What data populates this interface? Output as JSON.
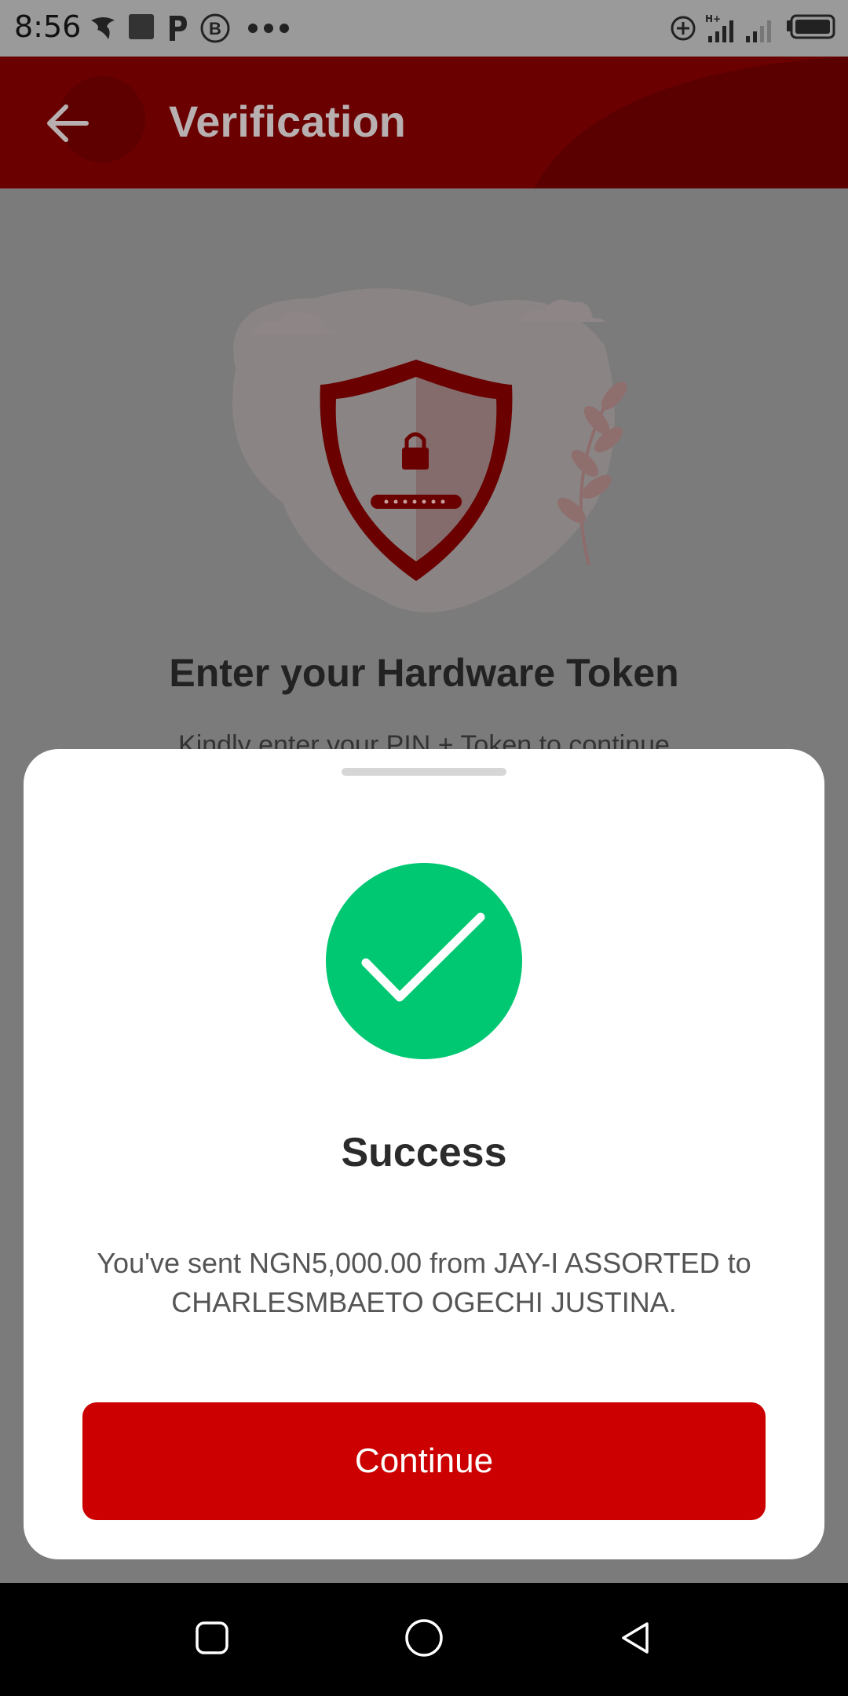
{
  "status_bar": {
    "time": "8:56",
    "icons": [
      "bird-icon",
      "square-app-icon",
      "p-app-icon",
      "b-circle-icon",
      "more-dots-icon",
      "data-saver-icon",
      "signal-hplus-icon",
      "signal-icon",
      "battery-icon"
    ]
  },
  "app_bar": {
    "title": "Verification",
    "back_icon": "arrow-left-icon",
    "color": "#6b0000"
  },
  "content": {
    "heading": "Enter your Hardware Token",
    "subtext": "Kindly enter your PIN + Token to continue"
  },
  "sheet": {
    "title": "Success",
    "message": "You've sent NGN5,000.00 from JAY-I ASSORTED to CHARLESMBAETO OGECHI JUSTINA.",
    "button_label": "Continue",
    "success_color": "#00c872",
    "button_color": "#cc0000"
  },
  "nav_bar": {
    "icons": [
      "recents-square-icon",
      "home-circle-icon",
      "back-triangle-icon"
    ]
  }
}
